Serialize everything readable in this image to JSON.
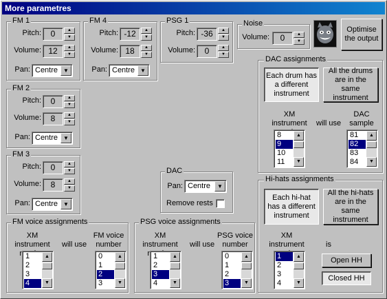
{
  "window": {
    "title": "More parametres"
  },
  "labels": {
    "pitch": "Pitch:",
    "volume": "Volume:",
    "pan": "Pan:"
  },
  "fm1": {
    "title": "FM 1",
    "pitch": "0",
    "volume": "12",
    "pan": "Centre"
  },
  "fm2": {
    "title": "FM 2",
    "pitch": "0",
    "volume": "8",
    "pan": "Centre"
  },
  "fm3": {
    "title": "FM 3",
    "pitch": "0",
    "volume": "8",
    "pan": "Centre"
  },
  "fm4": {
    "title": "FM 4",
    "pitch": "-12",
    "volume": "18",
    "pan": "Centre"
  },
  "psg1": {
    "title": "PSG 1",
    "pitch": "-36",
    "volume": "0"
  },
  "noise": {
    "title": "Noise",
    "volume_label": "Volume:",
    "volume": "0"
  },
  "optimise_button": "Optimise the output",
  "mascot": {
    "icon": "mascot-creature-icon"
  },
  "dac": {
    "title": "DAC",
    "pan_label": "Pan:",
    "pan": "Centre",
    "remove_rests_label": "Remove rests",
    "remove_rests": false
  },
  "dac_assign": {
    "title": "DAC assignments",
    "different_button": "Each drum has a different instrument",
    "same_button": "All the drums are in the same instrument",
    "xm_label": "XM instrument number",
    "will_use": "will use",
    "dac_label": "DAC sample",
    "xm_items": [
      "8",
      "9",
      "10",
      "11"
    ],
    "xm_selected": 1,
    "dac_items": [
      "81",
      "82",
      "83",
      "84"
    ],
    "dac_selected": 1
  },
  "hihat": {
    "title": "Hi-hats assignments",
    "different_button": "Each hi-hat has a different instrument",
    "same_button": "All the hi-hats are in the same instrument",
    "xm_label": "XM instrument number",
    "is_label": "is",
    "xm_items": [
      "1",
      "2",
      "3",
      "4"
    ],
    "xm_selected": 0,
    "open_button": "Open HH",
    "closed_button": "Closed HH"
  },
  "fm_voice": {
    "title": "FM voice assignments",
    "xm_label": "XM instrument number",
    "will_use": "will use",
    "voice_label": "FM voice number",
    "xm_items": [
      "1",
      "2",
      "3",
      "4"
    ],
    "xm_selected": 3,
    "voice_items": [
      "0",
      "1",
      "2",
      "3"
    ],
    "voice_selected": 2
  },
  "psg_voice": {
    "title": "PSG voice assignments",
    "xm_label": "XM instrument number",
    "will_use": "will use",
    "voice_label": "PSG voice number",
    "xm_items": [
      "1",
      "2",
      "3",
      "4"
    ],
    "xm_selected": 2,
    "voice_items": [
      "0",
      "1",
      "2",
      "3"
    ],
    "voice_selected": 3
  },
  "colors": {
    "selection": "#000080",
    "face": "#c0c0c0",
    "titlebar": "#000080"
  }
}
